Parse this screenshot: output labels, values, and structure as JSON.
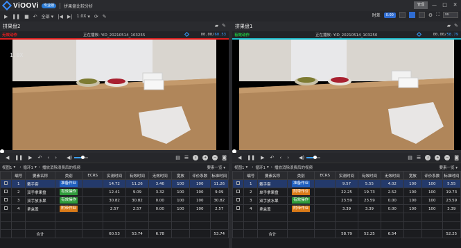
{
  "app": {
    "brand": "ViOOVi",
    "badge": "专业版",
    "subtitle": "拼果盘比较分析",
    "window_controls": {
      "restore": "管理",
      "minimize": "—",
      "maximize": "□",
      "close": "✕"
    }
  },
  "toolbar": {
    "all_label": "全部",
    "speed": "1.0X",
    "time_label": "时差",
    "time_value": "0.00",
    "sync_value": "ss"
  },
  "panels": [
    {
      "title": "拼果盘2",
      "status": "无效动作",
      "status_color": "#e02020",
      "playing_prefix": "正在播放:",
      "file": "YID_20210514_103255",
      "time_current": "00.00/",
      "time_total": "60.53",
      "speed_overlay": "1.0X",
      "accent": "#e02020",
      "progress": 0.0,
      "volume": 0.6,
      "cycle_view": "视图1",
      "cycle_label": "循环1",
      "cycle_desc": "播放消除浪费后的视频",
      "summary_label": "要素一览",
      "rows": [
        {
          "no": "1",
          "name": "戴手套",
          "cat": "准备作业",
          "ecrs": "",
          "actual": "14.72",
          "valid": "11.26",
          "invalid": "3.46",
          "rate": "100",
          "eval": "100",
          "std": "11.26"
        },
        {
          "no": "2",
          "name": "双手拿果盘",
          "cat": "有效操作",
          "ecrs": "",
          "actual": "12.41",
          "valid": "9.09",
          "invalid": "3.32",
          "rate": "100",
          "eval": "100",
          "std": "9.09"
        },
        {
          "no": "3",
          "name": "双手放水果",
          "cat": "有效操作",
          "ecrs": "",
          "actual": "30.82",
          "valid": "30.82",
          "invalid": "0.00",
          "rate": "100",
          "eval": "100",
          "std": "30.82"
        },
        {
          "no": "4",
          "name": "拿盒盖",
          "cat": "附带作业",
          "ecrs": "",
          "actual": "2.57",
          "valid": "2.57",
          "invalid": "0.00",
          "rate": "100",
          "eval": "100",
          "std": "2.57"
        }
      ],
      "total": {
        "label": "合计",
        "actual": "60.53",
        "valid": "53.74",
        "invalid": "6.78",
        "std": "53.74"
      }
    },
    {
      "title": "拼果盘1",
      "status": "有效动作",
      "status_color": "#20c040",
      "playing_prefix": "正在播放:",
      "file": "YID_20210514_103250",
      "time_current": "00.00/",
      "time_total": "58.79",
      "speed_overlay": "",
      "accent": "#20c0d0",
      "progress": 0.0,
      "volume": 0.6,
      "cycle_view": "视图1",
      "cycle_label": "循环1",
      "cycle_desc": "播放消除浪费后的视频",
      "summary_label": "要素一览",
      "rows": [
        {
          "no": "1",
          "name": "戴手套",
          "cat": "准备作业",
          "ecrs": "",
          "actual": "9.57",
          "valid": "5.55",
          "invalid": "4.02",
          "rate": "100",
          "eval": "100",
          "std": "5.55"
        },
        {
          "no": "2",
          "name": "单手拿果盘",
          "cat": "附带作业",
          "ecrs": "",
          "actual": "22.25",
          "valid": "19.73",
          "invalid": "2.52",
          "rate": "100",
          "eval": "100",
          "std": "19.73"
        },
        {
          "no": "3",
          "name": "双手放水果",
          "cat": "有效操作",
          "ecrs": "",
          "actual": "23.59",
          "valid": "23.59",
          "invalid": "0.00",
          "rate": "100",
          "eval": "100",
          "std": "23.59"
        },
        {
          "no": "4",
          "name": "拿盒盖",
          "cat": "附带作业",
          "ecrs": "",
          "actual": "3.39",
          "valid": "3.39",
          "invalid": "0.00",
          "rate": "100",
          "eval": "100",
          "std": "3.39"
        }
      ],
      "total": {
        "label": "合计",
        "actual": "58.79",
        "valid": "52.25",
        "invalid": "6.54",
        "std": "52.25"
      }
    }
  ],
  "columns": [
    "编号",
    "要素名称",
    "类别",
    "ECRS",
    "实测时间",
    "有效时间",
    "无效时间",
    "宽放",
    "评价系数",
    "标准时间"
  ],
  "category_colors": {
    "准备作业": "#1f5fbf",
    "有效操作": "#2f9a3a",
    "附带作业": "#d97a18"
  }
}
